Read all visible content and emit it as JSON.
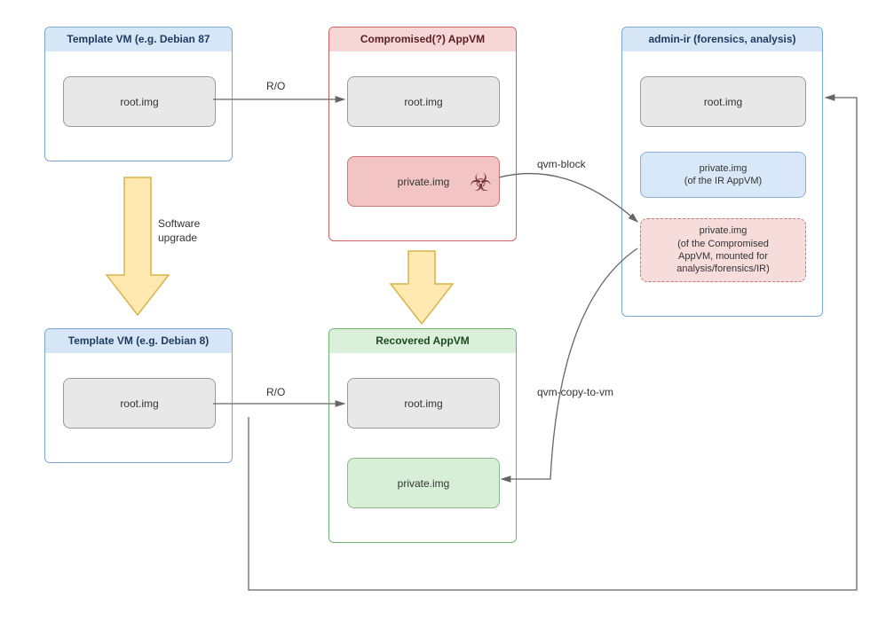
{
  "boxes": {
    "template_vm_top": {
      "title": "Template VM (e.g. Debian 87",
      "root": "root.img"
    },
    "compromised_appvm": {
      "title": "Compromised(?) AppVM",
      "root": "root.img",
      "private": "private.img"
    },
    "admin_ir": {
      "title": "admin-ir (forensics, analysis)",
      "root": "root.img",
      "private_ir_line1": "private.img",
      "private_ir_line2": "(of the IR AppVM)",
      "mounted_line1": "private.img",
      "mounted_line2": "(of the Compromised",
      "mounted_line3": "AppVM, mounted for",
      "mounted_line4": "analysis/forensics/IR)"
    },
    "template_vm_bottom": {
      "title": "Template VM (e.g. Debian 8)",
      "root": "root.img"
    },
    "recovered_appvm": {
      "title": "Recovered AppVM",
      "root": "root.img",
      "private": "private.img"
    }
  },
  "edges": {
    "ro_top": "R/O",
    "ro_bottom": "R/O",
    "software_upgrade_1": "Software",
    "software_upgrade_2": "upgrade",
    "qvm_block": "qvm-block",
    "qvm_copy": "qvm-copy-to-vm"
  },
  "icons": {
    "biohazard": "biohazard-icon"
  }
}
